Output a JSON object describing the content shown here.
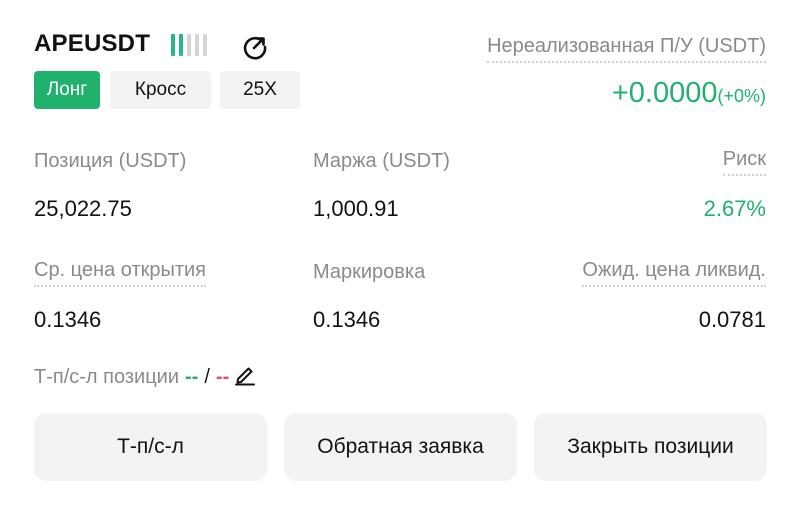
{
  "header": {
    "symbol": "APEUSDT",
    "adl_level": 2,
    "adl_bars_total": 5,
    "share_icon": "share-icon",
    "side_label": "Лонг",
    "margin_mode_label": "Кросс",
    "leverage_label": "25X"
  },
  "pnl": {
    "label": "Нереализованная П/У (USDT)",
    "value": "+0.0000",
    "percent": "(+0%)"
  },
  "stats": {
    "position_label": "Позиция (USDT)",
    "position_value": "25,022.75",
    "margin_label": "Маржа (USDT)",
    "margin_value": "1,000.91",
    "risk_label": "Риск",
    "risk_value": "2.67%",
    "entry_label": "Ср. цена открытия",
    "entry_value": "0.1346",
    "mark_label": "Маркировка",
    "mark_value": "0.1346",
    "liq_label": "Ожид. цена ликвид.",
    "liq_value": "0.0781"
  },
  "tpsl": {
    "label": "Т-п/с-л позиции",
    "tp": "--",
    "separator": "/",
    "sl": "--",
    "edit_icon": "pencil-icon"
  },
  "actions": {
    "tpsl_button": "Т-п/с-л",
    "reverse_button": "Обратная заявка",
    "close_button": "Закрыть позиции"
  },
  "colors": {
    "accent_green": "#20b26c",
    "loss_red": "#e2505b",
    "button_bg": "#f3f3f3",
    "muted_text": "#8a8a8a"
  }
}
